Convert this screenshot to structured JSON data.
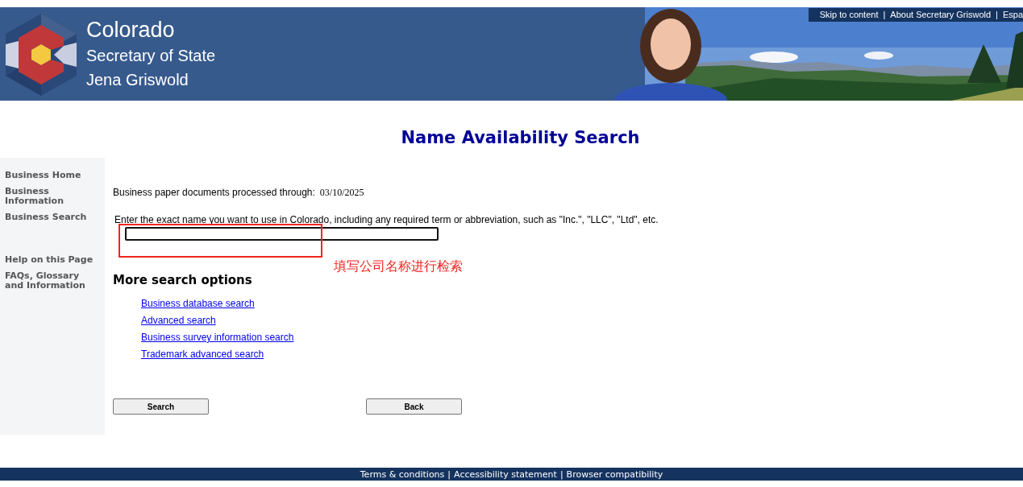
{
  "header": {
    "title": "Colorado",
    "subtitle": "Secretary of State",
    "name": "Jena Griswold",
    "top_links": [
      {
        "label": "Skip to content"
      },
      {
        "label": "About Secretary Griswold"
      },
      {
        "label": "Espa"
      }
    ],
    "separator": "|"
  },
  "page_title": "Name Availability Search",
  "sidebar": {
    "sections": [
      [
        {
          "label": "Business Home"
        },
        {
          "label": "Business Information"
        },
        {
          "label": "Business Search"
        }
      ],
      [
        {
          "label": "Help on this Page"
        },
        {
          "label": "FAQs, Glossary and Information"
        }
      ]
    ]
  },
  "content": {
    "processed_label": "Business paper documents processed through:",
    "processed_date": "03/10/2025",
    "instruction": "Enter the exact name you want to use in Colorado, including any required term or abbreviation, such as \"Inc.\", \"LLC\", \"Ltd\", etc.",
    "more_heading": "More search options",
    "links": [
      {
        "label": "Business database search"
      },
      {
        "label": "Advanced search"
      },
      {
        "label": "Business survey information search"
      },
      {
        "label": "Trademark advanced search"
      }
    ],
    "buttons": [
      {
        "label": "Search"
      },
      {
        "label": "Back"
      }
    ]
  },
  "annotation": {
    "text": "填写公司名称进行检索"
  },
  "footer": {
    "links": [
      {
        "label": "Terms & conditions"
      },
      {
        "label": "Accessibility statement"
      },
      {
        "label": "Browser compatibility"
      }
    ],
    "separator": "|"
  }
}
